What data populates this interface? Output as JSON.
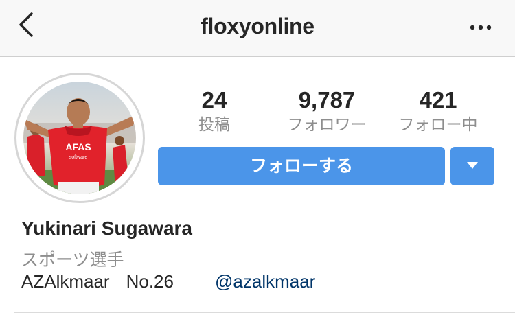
{
  "nav": {
    "title": "floxyonline",
    "back_icon": "chevron-left-icon",
    "more_icon": "more-horizontal-icon"
  },
  "stats": {
    "posts": {
      "value": "24",
      "label": "投稿"
    },
    "followers": {
      "value": "9,787",
      "label": "フォロワー"
    },
    "following": {
      "value": "421",
      "label": "フォロー中"
    }
  },
  "actions": {
    "follow_label": "フォローする",
    "dropdown_icon": "caret-down-icon"
  },
  "profile": {
    "name": "Yukinari Sugawara",
    "category": "スポーツ選手",
    "team": "AZAlkmaar",
    "number": "No.26",
    "link": "@azalkmaar"
  },
  "colors": {
    "accent": "#4b95e9",
    "link": "#003569",
    "muted": "#8e8e8e",
    "text": "#262626"
  }
}
